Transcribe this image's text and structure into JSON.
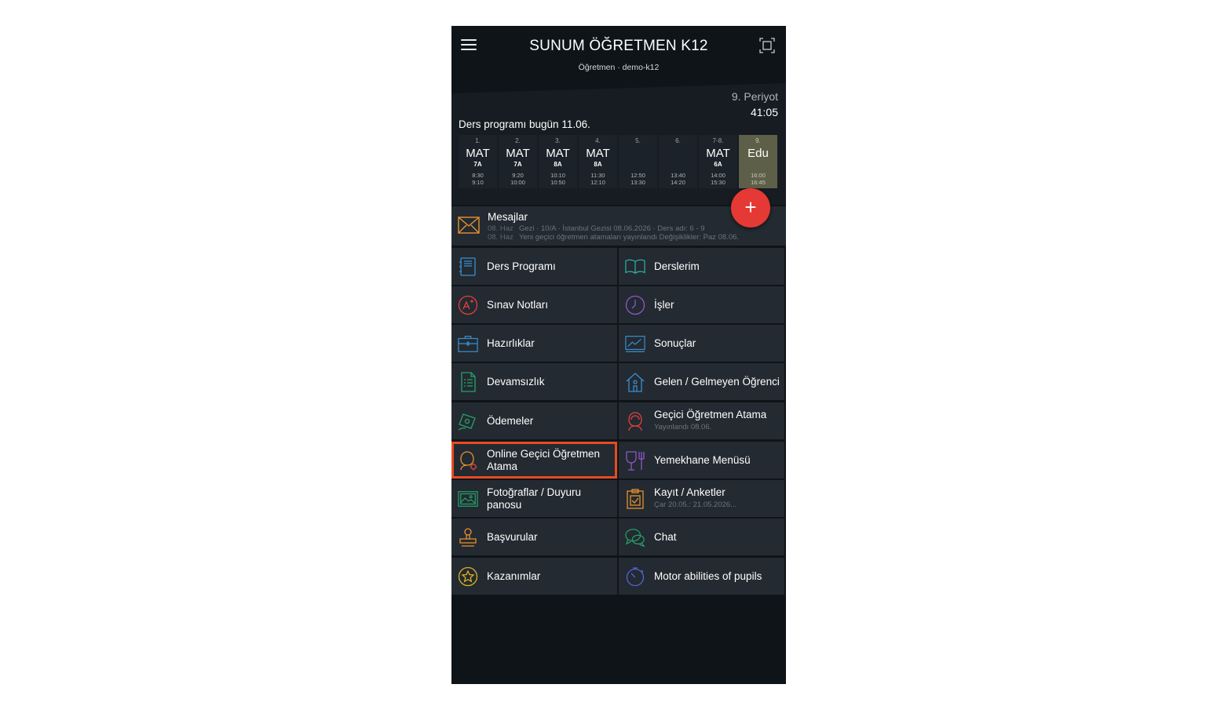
{
  "header": {
    "title": "SUNUM ÖĞRETMEN K12",
    "subtitle": "Öğretmen · demo-k12",
    "menu_icon": "hamburger-menu-icon",
    "fullscreen_icon": "fullscreen-icon"
  },
  "schedule": {
    "period": "9. Periyot",
    "timer": "41:05",
    "today_label": "Ders programı bugün 11.06.",
    "slots": [
      {
        "num": "1.",
        "subject": "MAT",
        "class": "7A",
        "start": "8:30",
        "end": "9:10"
      },
      {
        "num": "2.",
        "subject": "MAT",
        "class": "7A",
        "start": "9:20",
        "end": "10:00"
      },
      {
        "num": "3.",
        "subject": "MAT",
        "class": "8A",
        "start": "10:10",
        "end": "10:50"
      },
      {
        "num": "4.",
        "subject": "MAT",
        "class": "8A",
        "start": "11:30",
        "end": "12:10"
      },
      {
        "num": "5.",
        "subject": "",
        "class": "",
        "start": "12:50",
        "end": "13:30"
      },
      {
        "num": "6.",
        "subject": "",
        "class": "",
        "start": "13:40",
        "end": "14:20"
      },
      {
        "num": "7-8.",
        "subject": "MAT",
        "class": "6A",
        "start": "14:00",
        "end": "15:30"
      },
      {
        "num": "9.",
        "subject": "Edu",
        "class": "",
        "start": "16:00",
        "end": "16:45"
      }
    ]
  },
  "fab": {
    "label": "+"
  },
  "messages": {
    "title": "Mesajlar",
    "items": [
      {
        "date": "08. Haz",
        "text": "Gezi · 10/A · İstanbul Gezisi 08.06.2026 · Ders adı: 6 - 9"
      },
      {
        "date": "08. Haz",
        "text": "Yeni geçici öğretmen atamaları yayınlandı Değişiklikler: Paz 08.06."
      }
    ]
  },
  "tiles": {
    "ders_programi": {
      "label": "Ders Programı"
    },
    "derslerim": {
      "label": "Derslerim"
    },
    "sinav_notlari": {
      "label": "Sınav Notları"
    },
    "isler": {
      "label": "İşler"
    },
    "hazirliklar": {
      "label": "Hazırlıklar"
    },
    "sonuclar": {
      "label": "Sonuçlar"
    },
    "devamsizlik": {
      "label": "Devamsızlık"
    },
    "gelen_gelmeyen": {
      "label": "Gelen / Gelmeyen Öğrenci"
    },
    "odemeler": {
      "label": "Ödemeler"
    },
    "gecici_atama": {
      "label": "Geçici Öğretmen Atama",
      "sub": "Yayınlandı 08.06."
    },
    "online_gecici": {
      "label": "Online Geçici Öğretmen Atama"
    },
    "yemekhane": {
      "label": "Yemekhane Menüsü"
    },
    "fotograflar": {
      "label": "Fotoğraflar / Duyuru panosu"
    },
    "kayit": {
      "label": "Kayıt / Anketler",
      "sub": "Çar 20.05.: 21.05.2026..."
    },
    "basvurular": {
      "label": "Başvurular"
    },
    "chat": {
      "label": "Chat"
    },
    "kazanimlar": {
      "label": "Kazanımlar"
    },
    "motor": {
      "label": "Motor abilities of pupils"
    }
  },
  "colors": {
    "background": "#0f1419",
    "tile": "#232a31",
    "active_slot": "#5e5f48",
    "fab": "#e53935",
    "highlight": "#e84a23"
  }
}
